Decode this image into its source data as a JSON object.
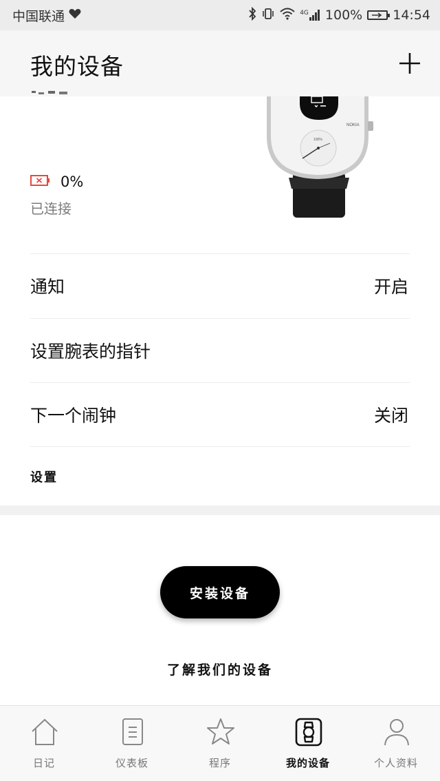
{
  "status_bar": {
    "carrier": "中国联通",
    "signal_label": "4G",
    "battery_percent": "100%",
    "time": "14:54"
  },
  "header": {
    "title": "我的设备",
    "add_icon": "plus-icon"
  },
  "device": {
    "battery_level": "0%",
    "connection_status": "已连接",
    "watch_brand": "NOKIA",
    "watch_dial_text": "100%"
  },
  "settings_rows": [
    {
      "label": "通知",
      "value": "开启"
    },
    {
      "label": "设置腕表的指针",
      "value": ""
    },
    {
      "label": "下一个闹钟",
      "value": "关闭"
    }
  ],
  "settings_heading": "设置",
  "install_button": "安装设备",
  "learn_link": "了解我们的设备",
  "bottom_nav": [
    {
      "label": "日记",
      "icon": "home-icon",
      "active": false
    },
    {
      "label": "仪表板",
      "icon": "document-icon",
      "active": false
    },
    {
      "label": "程序",
      "icon": "star-icon",
      "active": false
    },
    {
      "label": "我的设备",
      "icon": "watch-icon",
      "active": true
    },
    {
      "label": "个人资料",
      "icon": "profile-icon",
      "active": false
    }
  ],
  "colors": {
    "battery_low": "#e8473c",
    "button_bg": "#000000",
    "muted_text": "#7b7b7b"
  }
}
